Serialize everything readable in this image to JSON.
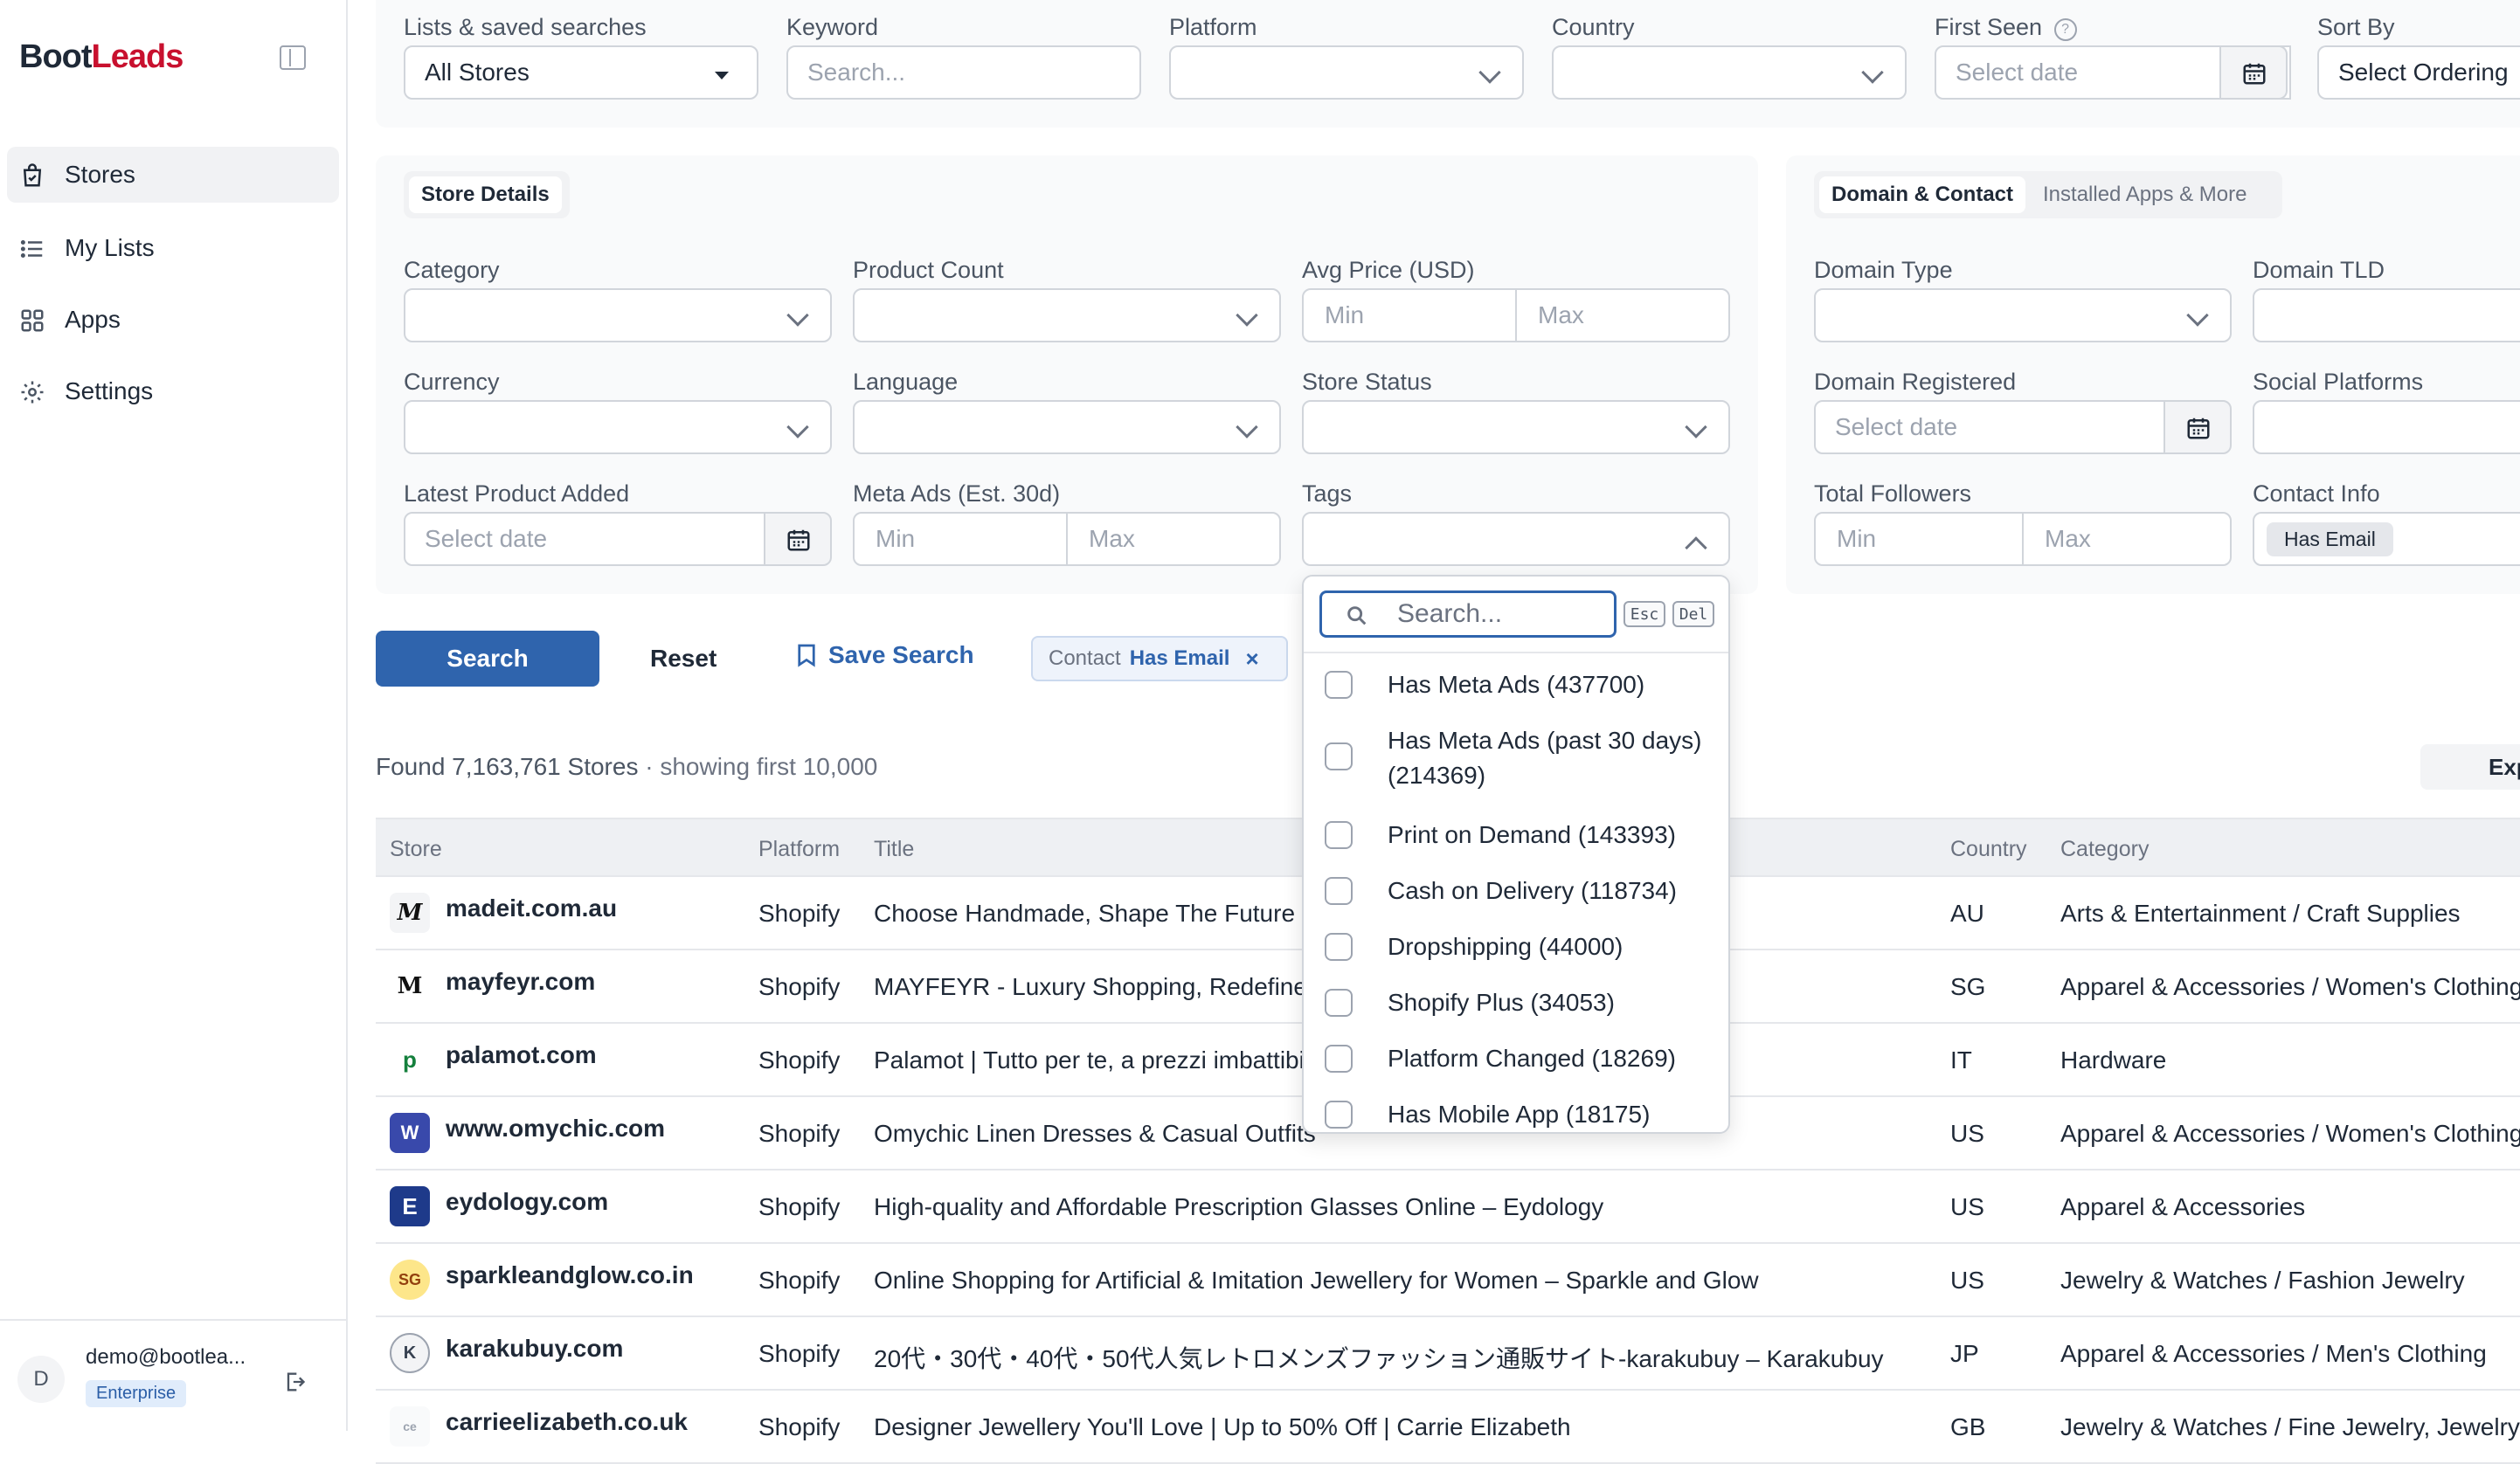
{
  "sidebar": {
    "logo_part1": "Boot",
    "logo_part2": "Leads",
    "nav": [
      {
        "label": "Stores",
        "icon": "bag-check-icon",
        "active": true
      },
      {
        "label": "My Lists",
        "icon": "list-icon",
        "active": false
      },
      {
        "label": "Apps",
        "icon": "grid-icon",
        "active": false
      },
      {
        "label": "Settings",
        "icon": "gear-icon",
        "active": false
      }
    ],
    "user": {
      "initial": "D",
      "email": "demo@bootlea...",
      "plan": "Enterprise"
    }
  },
  "topFilters": {
    "lists": {
      "label": "Lists & saved searches",
      "value": "All Stores"
    },
    "keyword": {
      "label": "Keyword",
      "placeholder": "Search..."
    },
    "platform": {
      "label": "Platform",
      "value": ""
    },
    "country": {
      "label": "Country",
      "value": ""
    },
    "firstSeen": {
      "label": "First Seen",
      "help": "?",
      "placeholder": "Select date"
    },
    "sortBy": {
      "label": "Sort By",
      "value": "Select Ordering"
    }
  },
  "storeDetails": {
    "tab": "Store Details",
    "category": {
      "label": "Category"
    },
    "productCount": {
      "label": "Product Count"
    },
    "avgPrice": {
      "label": "Avg Price (USD)",
      "min": "Min",
      "max": "Max"
    },
    "currency": {
      "label": "Currency"
    },
    "language": {
      "label": "Language"
    },
    "storeStatus": {
      "label": "Store Status"
    },
    "latestProduct": {
      "label": "Latest Product Added",
      "placeholder": "Select date"
    },
    "metaAds": {
      "label": "Meta Ads (Est. 30d)",
      "min": "Min",
      "max": "Max"
    },
    "tags": {
      "label": "Tags"
    }
  },
  "domainContact": {
    "tabs": [
      "Domain & Contact",
      "Installed Apps & More"
    ],
    "domainType": {
      "label": "Domain Type"
    },
    "domainTld": {
      "label": "Domain TLD"
    },
    "domainRegistered": {
      "label": "Domain Registered",
      "placeholder": "Select date"
    },
    "socialPlatforms": {
      "label": "Social Platforms"
    },
    "totalFollowers": {
      "label": "Total Followers",
      "min": "Min",
      "max": "Max"
    },
    "contactInfo": {
      "label": "Contact Info",
      "tag": "Has Email"
    }
  },
  "actions": {
    "search": "Search",
    "reset": "Reset",
    "save": "Save Search",
    "chip": {
      "key": "Contact",
      "value": "Has Email",
      "remove": "×"
    }
  },
  "results": {
    "found": "Found 7,163,761 Stores",
    "showing": " · showing first 10,000",
    "export": "Export"
  },
  "table": {
    "headers": [
      "Store",
      "Platform",
      "Title",
      "Country",
      "Category"
    ],
    "rows": [
      {
        "store": "madeit.com.au",
        "platform": "Shopify",
        "title": "Choose Handmade, Shape The Future",
        "country": "AU",
        "category": "Arts & Entertainment / Craft Supplies",
        "favicon": "M"
      },
      {
        "store": "mayfeyr.com",
        "platform": "Shopify",
        "title": "MAYFEYR - Luxury Shopping, Redefined",
        "country": "SG",
        "category": "Apparel & Accessories / Women's Clothing",
        "favicon": "M"
      },
      {
        "store": "palamot.com",
        "platform": "Shopify",
        "title": "Palamot | Tutto per te, a prezzi imbattibili",
        "country": "IT",
        "category": "Hardware",
        "favicon": "p"
      },
      {
        "store": "www.omychic.com",
        "platform": "Shopify",
        "title": "Omychic Linen Dresses & Casual Outfits",
        "country": "US",
        "category": "Apparel & Accessories / Women's Clothing",
        "favicon": "W"
      },
      {
        "store": "eydology.com",
        "platform": "Shopify",
        "title": "High-quality and Affordable Prescription Glasses Online – Eydology",
        "country": "US",
        "category": "Apparel & Accessories",
        "favicon": "E"
      },
      {
        "store": "sparkleandglow.co.in",
        "platform": "Shopify",
        "title": "Online Shopping for Artificial & Imitation Jewellery for Women – Sparkle and Glow",
        "country": "US",
        "category": "Jewelry & Watches / Fashion Jewelry",
        "favicon": "SG"
      },
      {
        "store": "karakubuy.com",
        "platform": "Shopify",
        "title": "20代・30代・40代・50代人気レトロメンズファッション通販サイト-karakubuy – Karakubuy",
        "country": "JP",
        "category": "Apparel & Accessories / Men's Clothing",
        "favicon": "K"
      },
      {
        "store": "carrieelizabeth.co.uk",
        "platform": "Shopify",
        "title": "Designer Jewellery You'll Love | Up to 50% Off | Carrie Elizabeth",
        "country": "GB",
        "category": "Jewelry & Watches / Fine Jewelry, Jewelry",
        "favicon": "ce"
      }
    ]
  },
  "tagsDropdown": {
    "placeholder": "Search...",
    "esc": "Esc",
    "del": "Del",
    "options": [
      {
        "line1": "Has Meta Ads (437700)"
      },
      {
        "line1": "Has Meta Ads (past 30 days)",
        "line2": "(214369)"
      },
      {
        "line1": "Print on Demand (143393)"
      },
      {
        "line1": "Cash on Delivery (118734)"
      },
      {
        "line1": "Dropshipping (44000)"
      },
      {
        "line1": "Shopify Plus (34053)"
      },
      {
        "line1": "Platform Changed (18269)"
      },
      {
        "line1": "Has Mobile App (18175)"
      }
    ]
  }
}
